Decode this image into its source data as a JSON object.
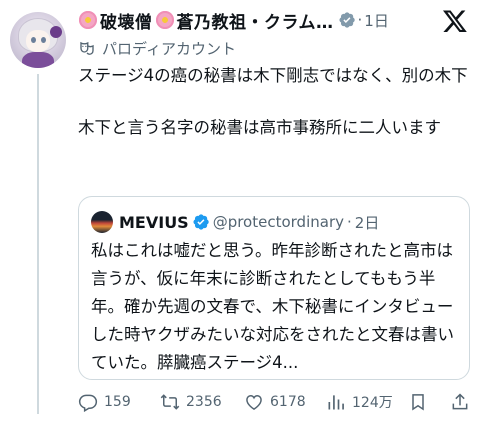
{
  "post": {
    "author": {
      "display_name_part1": "破壊僧",
      "display_name_part2": "蒼乃教祖・クラム…",
      "timestamp": "1日",
      "parody_label": "パロディアカウント"
    },
    "text_line1": "ステージ4の癌の秘書は木下剛志ではなく、別の木下",
    "text_line2": "木下と言う名字の秘書は高市事務所に二人います"
  },
  "quote": {
    "name": "MEVIUS",
    "handle": "@protectordinary",
    "separator": "·",
    "timestamp": "2日",
    "text": "私はこれは嘘だと思う。昨年診断されたと高市は言うが、仮に年末に診断されたとしてももう半年。確か先週の文春で、木下秘書にインタビューした時ヤクザみたいな対応をされたと文春は書いていた。膵臓癌ステージ4..."
  },
  "metrics": {
    "replies": "159",
    "reposts": "2356",
    "likes": "6178",
    "views": "124万"
  },
  "meta_separator": "·",
  "colors": {
    "text": "#0f1419",
    "secondary": "#536471",
    "border": "#cfd9de",
    "verified_blue": "#1d9bf0",
    "verified_gray": "#829aab"
  }
}
